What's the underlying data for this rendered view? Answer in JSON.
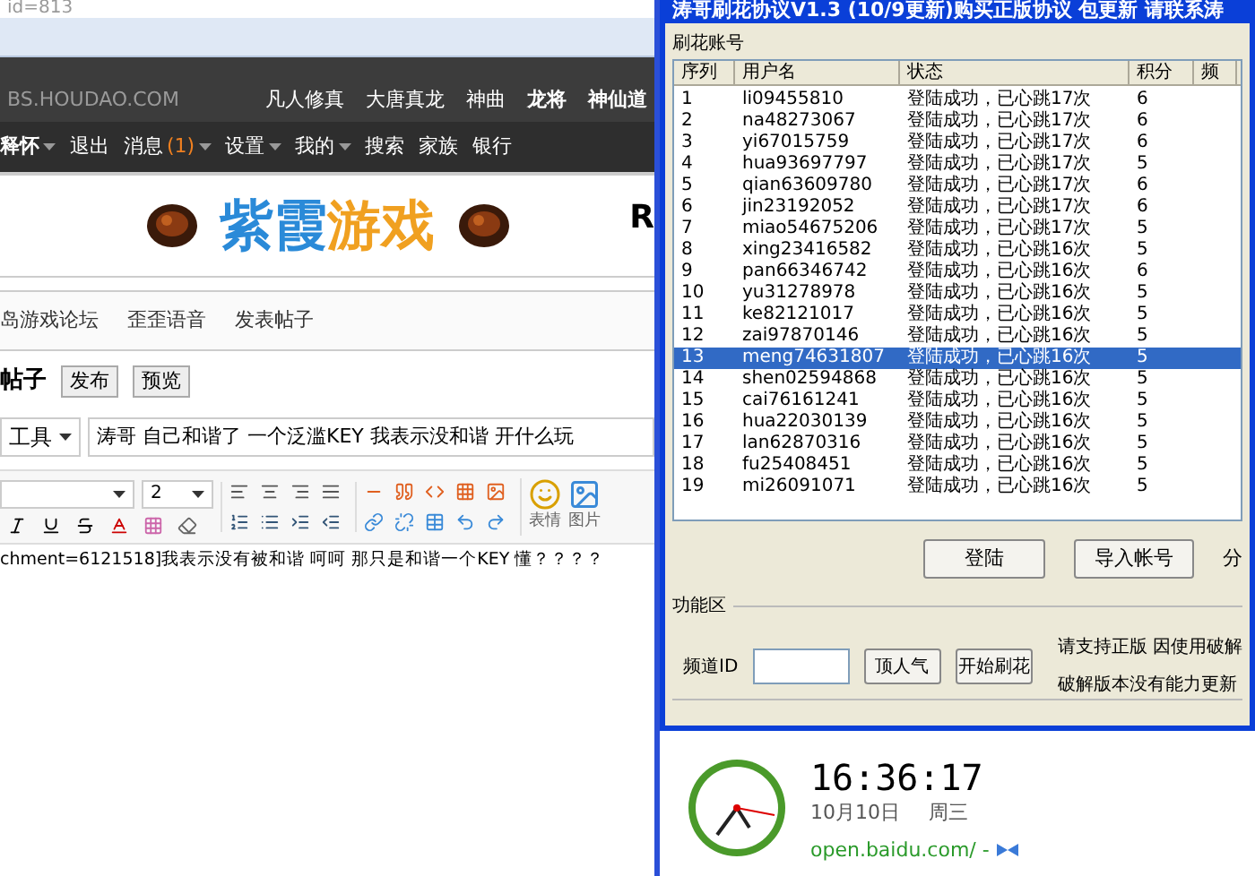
{
  "browser": {
    "address": "id=813"
  },
  "site_header": {
    "domain": "BS.HOUDAO.COM",
    "nav": [
      {
        "label": "凡人修真",
        "bold": false
      },
      {
        "label": "大唐真龙",
        "bold": false
      },
      {
        "label": "神曲",
        "bold": false
      },
      {
        "label": "龙将",
        "bold": true
      },
      {
        "label": "神仙道",
        "bold": true
      }
    ]
  },
  "menu": [
    {
      "label": "释怀",
      "dropdown": true,
      "bold": true
    },
    {
      "label": "退出",
      "dropdown": false,
      "bold": false
    },
    {
      "label": "消息",
      "count": "(1)",
      "dropdown": true,
      "bold": false
    },
    {
      "label": "设置",
      "dropdown": true,
      "bold": false
    },
    {
      "label": "我的",
      "dropdown": true,
      "bold": false
    },
    {
      "label": "搜索",
      "dropdown": false,
      "bold": false
    },
    {
      "label": "家族",
      "dropdown": false,
      "bold": false
    },
    {
      "label": "银行",
      "dropdown": false,
      "bold": false
    }
  ],
  "banner": {
    "title_a": "紫霞",
    "title_b": "游戏",
    "edge": "R"
  },
  "breadcrumb": [
    "岛游戏论坛",
    "歪歪语音",
    "发表帖子"
  ],
  "post_form": {
    "heading": "帖子",
    "buttons": [
      "发布",
      "预览"
    ],
    "category": "工具",
    "subject": "涛哥 自己和谐了 一个泛滥KEY  我表示没和谐  开什么玩",
    "font_size": "2",
    "smiley_label": "表情",
    "image_label": "图片",
    "body": "chment=6121518]我表示没有被和谐 呵呵  那只是和谐一个KEY  懂？？？？"
  },
  "app_window": {
    "title": "涛哥刷花协议V1.3 (10/9更新)购买正版协议 包更新 请联系涛",
    "accounts_group": "刷花账号",
    "columns": [
      "序列",
      "用户名",
      "状态",
      "积分",
      "频"
    ],
    "rows": [
      {
        "cells": [
          "1",
          "li09455810",
          "登陆成功，已心跳17次",
          "6"
        ],
        "selected": false
      },
      {
        "cells": [
          "2",
          "na48273067",
          "登陆成功，已心跳17次",
          "6"
        ],
        "selected": false
      },
      {
        "cells": [
          "3",
          "yi67015759",
          "登陆成功，已心跳17次",
          "6"
        ],
        "selected": false
      },
      {
        "cells": [
          "4",
          "hua93697797",
          "登陆成功，已心跳17次",
          "5"
        ],
        "selected": false
      },
      {
        "cells": [
          "5",
          "qian63609780",
          "登陆成功，已心跳17次",
          "6"
        ],
        "selected": false
      },
      {
        "cells": [
          "6",
          "jin23192052",
          "登陆成功，已心跳17次",
          "6"
        ],
        "selected": false
      },
      {
        "cells": [
          "7",
          "miao54675206",
          "登陆成功，已心跳17次",
          "5"
        ],
        "selected": false
      },
      {
        "cells": [
          "8",
          "xing23416582",
          "登陆成功，已心跳16次",
          "5"
        ],
        "selected": false
      },
      {
        "cells": [
          "9",
          "pan66346742",
          "登陆成功，已心跳16次",
          "6"
        ],
        "selected": false
      },
      {
        "cells": [
          "10",
          "yu31278978",
          "登陆成功，已心跳16次",
          "5"
        ],
        "selected": false
      },
      {
        "cells": [
          "11",
          "ke82121017",
          "登陆成功，已心跳16次",
          "5"
        ],
        "selected": false
      },
      {
        "cells": [
          "12",
          "zai97870146",
          "登陆成功，已心跳16次",
          "5"
        ],
        "selected": false
      },
      {
        "cells": [
          "13",
          "meng74631807",
          "登陆成功，已心跳16次",
          "5"
        ],
        "selected": true
      },
      {
        "cells": [
          "14",
          "shen02594868",
          "登陆成功，已心跳16次",
          "5"
        ],
        "selected": false
      },
      {
        "cells": [
          "15",
          "cai76161241",
          "登陆成功，已心跳16次",
          "5"
        ],
        "selected": false
      },
      {
        "cells": [
          "16",
          "hua22030139",
          "登陆成功，已心跳16次",
          "5"
        ],
        "selected": false
      },
      {
        "cells": [
          "17",
          "lan62870316",
          "登陆成功，已心跳16次",
          "5"
        ],
        "selected": false
      },
      {
        "cells": [
          "18",
          "fu25408451",
          "登陆成功，已心跳16次",
          "5"
        ],
        "selected": false
      },
      {
        "cells": [
          "19",
          "mi26091071",
          "登陆成功，已心跳16次",
          "5"
        ],
        "selected": false
      }
    ],
    "list_buttons": [
      "登陆",
      "导入帐号",
      "分"
    ],
    "function_group": "功能区",
    "channel_label": "频道ID",
    "function_buttons": [
      "顶人气",
      "开始刷花"
    ],
    "notice": [
      "请支持正版 因使用破解",
      "破解版本没有能力更新"
    ]
  },
  "clock_widget": {
    "time": "16:36:17",
    "date": "10月10日",
    "weekday": "周三",
    "source": "open.baidu.com/ -"
  }
}
